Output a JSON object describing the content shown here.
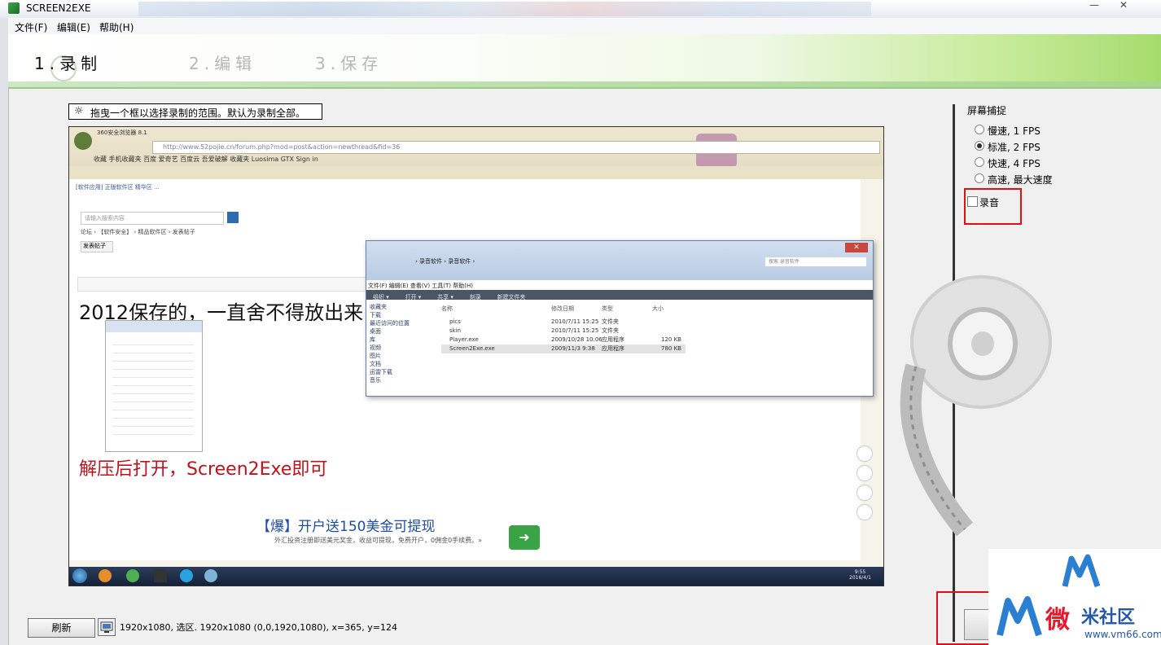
{
  "window": {
    "title": "SCREEN2EXE",
    "controls": [
      "—",
      "✕"
    ]
  },
  "menu": [
    "文件(F)",
    "编辑(E)",
    "帮助(H)"
  ],
  "steps": {
    "step1": "1.录制",
    "step2": "2.编辑",
    "step3": "3.保存"
  },
  "hint": {
    "icon": "sun-icon",
    "text": "拖曳一个框以选择录制的范围。默认为录制全部。"
  },
  "preview": {
    "browser_name": "360安全浏览器 8.1",
    "address": "http://www.52pojie.cn/forum.php?mod=post&action=newthread&fid=36",
    "bookmarks": "收藏  手机收藏夹  百度  爱奇艺  百度云  吾爱破解  收藏夹  Luosima  GTX  Sign in",
    "hotbar": "[软件应用] 正版软件区  精华区 ...",
    "forum_search": "请输入搜索内容",
    "breadcrumb": "论坛 › 【软件安全】 › 精品软件区 › 发表帖子",
    "post_tab": "发表帖子",
    "big_text": "2012保存的，一直舍不得放出来",
    "red_text": "解压后打开，Screen2Exe即可",
    "ad_title": "【爆】开户送150美金可提现",
    "ad_sub": "外汇投资注册即送美元奖金，收益可提现，免费开户，0佣金0手续费。»",
    "explorer": {
      "path": "› 录音软件 › 录音软件 ›",
      "search": "搜索 录音软件",
      "menu": "文件(F)  编辑(E)  查看(V)  工具(T)  帮助(H)",
      "tools": [
        "组织 ▾",
        "打开 ▾",
        "共享 ▾",
        "刻录",
        "新建文件夹"
      ],
      "side": [
        "收藏夹",
        "下载",
        "最近访问的位置",
        "桌面",
        "库",
        "视频",
        "图片",
        "文档",
        "迅雷下载",
        "音乐"
      ],
      "columns": [
        "名称",
        "修改日期",
        "类型",
        "大小"
      ],
      "rows": [
        {
          "name": "pics",
          "date": "2010/7/11 15:25",
          "type": "文件夹",
          "size": ""
        },
        {
          "name": "skin",
          "date": "2010/7/11 15:25",
          "type": "文件夹",
          "size": ""
        },
        {
          "name": "Player.exe",
          "date": "2009/10/28 10:06",
          "type": "应用程序",
          "size": "120 KB"
        },
        {
          "name": "Screen2Exe.exe",
          "date": "2009/11/3 9:38",
          "type": "应用程序",
          "size": "780 KB"
        }
      ]
    },
    "clock": "9:55\n2016/4/1"
  },
  "right_panel": {
    "title": "屏幕捕捉",
    "options": [
      {
        "label": "慢速, 1 FPS",
        "selected": false
      },
      {
        "label": "标准, 2 FPS",
        "selected": true
      },
      {
        "label": "快速, 4 FPS",
        "selected": false
      },
      {
        "label": "高速, 最大速度",
        "selected": false
      }
    ],
    "audio_label": "录音",
    "audio_checked": false
  },
  "bottom": {
    "refresh_label": "刷新",
    "status": "1920x1080, 选区. 1920x1080 (0,0,1920,1080), x=365, y=124"
  },
  "watermark": {
    "brand": "微",
    "brand_sub": "米社区",
    "url": "www.vm66.com"
  }
}
